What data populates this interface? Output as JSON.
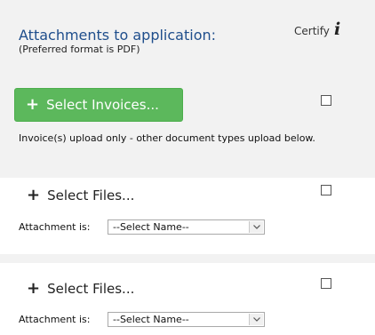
{
  "header": {
    "title": "Attachments to application:",
    "subtitle": "(Preferred format is PDF)",
    "certify_label": "Certify",
    "info_glyph": "i"
  },
  "invoices": {
    "button_label": "Select Invoices...",
    "plus_glyph": "+",
    "note": "Invoice(s) upload only - other document types upload below.",
    "certified": false
  },
  "attachments": [
    {
      "button_label": "Select Files...",
      "plus_glyph": "+",
      "label": "Attachment is:",
      "selected_name": "--Select Name--",
      "certified": false
    },
    {
      "button_label": "Select Files...",
      "plus_glyph": "+",
      "label": "Attachment is:",
      "selected_name": "--Select Name--",
      "certified": false
    }
  ],
  "icons": {
    "info": "info-icon",
    "plus": "plus-icon",
    "dropdown": "chevron-down-icon"
  },
  "colors": {
    "title": "#1f4e8c",
    "button_green": "#5cb85c",
    "panel_bg": "#f2f2f2"
  }
}
